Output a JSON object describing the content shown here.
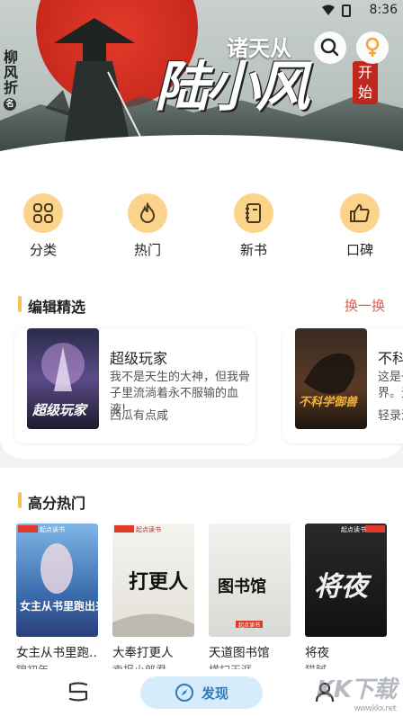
{
  "status_bar": {
    "time": "8:36"
  },
  "banner": {
    "author_vertical": [
      "柳",
      "风",
      "折"
    ],
    "seal": "名",
    "title_small": "诸天从",
    "title_big": "陆小风",
    "title_badge": "开始",
    "dots": 5,
    "active_dot": 2
  },
  "nav": {
    "items": [
      {
        "label": "分类",
        "icon": "grid-icon"
      },
      {
        "label": "热门",
        "icon": "flame-icon"
      },
      {
        "label": "新书",
        "icon": "notebook-icon"
      },
      {
        "label": "口碑",
        "icon": "thumb-up-icon"
      }
    ]
  },
  "editor_picks": {
    "title": "编辑精选",
    "swap_label": "换一换",
    "books": [
      {
        "title": "超级玩家",
        "desc": "我不是天生的大神，但我骨子里流淌着永不服输的血液!",
        "author": "西瓜有点咸",
        "cover_text": "超级玩家"
      },
      {
        "title": "不科",
        "desc": "这是一界。无",
        "author": "轻录流",
        "cover_text": "不科学御兽"
      }
    ]
  },
  "hot": {
    "title": "高分热门",
    "books": [
      {
        "title": "女主从书里跑…",
        "sub": "锦初年",
        "cover_text": "女主从书里跑出来了",
        "brand": "起点读书"
      },
      {
        "title": "大奉打更人",
        "sub": "卖报小郎君",
        "cover_text": "打更人",
        "brand": "起点读书"
      },
      {
        "title": "天道图书馆",
        "sub": "横扫天涯",
        "cover_text": "图书馆",
        "brand": "起点读书"
      },
      {
        "title": "将夜",
        "sub": "猫腻",
        "cover_text": "将夜",
        "brand": "起点读书"
      }
    ]
  },
  "bottom_bar": {
    "discover_label": "发现"
  },
  "watermark": {
    "main": "KK下载",
    "sub": "www.kkx.net"
  },
  "colors": {
    "accent_yellow": "#fcd38a",
    "swap_red": "#e55a4a",
    "discover_bg": "#d6ecfb",
    "discover_text": "#2f7ab8"
  }
}
